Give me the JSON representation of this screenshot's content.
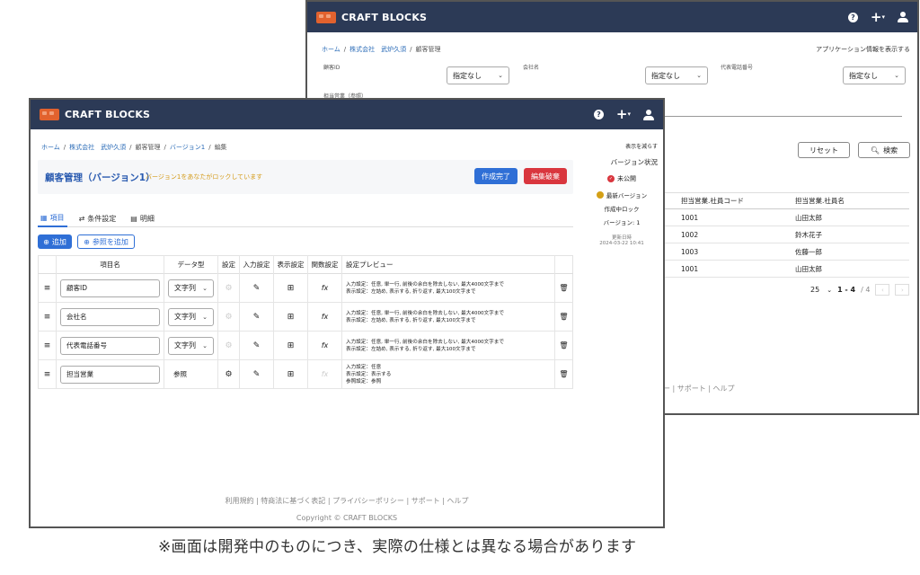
{
  "brand": "CRAFT BLOCKS",
  "caption": "※画面は開発中のものにつき、実際の仕様とは異なる場合があります",
  "back": {
    "breadcrumb": [
      "ホーム",
      "株式会社　武炉久須",
      "顧客管理"
    ],
    "show_app_info": "アプリケーション情報を表示する",
    "filters": [
      {
        "label": "顧客ID",
        "value": "指定なし"
      },
      {
        "label": "会社名",
        "value": "指定なし"
      },
      {
        "label": "代表電話番号",
        "value": "指定なし"
      }
    ],
    "owner_filter_label": "担当営業（参照）",
    "reset_label": "リセット",
    "search_label": "検索",
    "columns": [
      "担当営業.社員コード",
      "担当営業.社員名"
    ],
    "rows": [
      {
        "code": "1001",
        "name": "山田太郎",
        "left": ""
      },
      {
        "code": "1002",
        "name": "鈴木花子",
        "left": ""
      },
      {
        "code": "1003",
        "name": "佐藤一郎",
        "left": ""
      },
      {
        "code": "1001",
        "name": "山田太郎",
        "left": ""
      }
    ],
    "per_page": "25",
    "page_range": "1 - 4",
    "page_total": "/ 4",
    "footer": "ー | サポート | ヘルプ"
  },
  "front": {
    "breadcrumb": [
      "ホーム",
      "株式会社　武炉久須",
      "顧客管理",
      "バージョン1",
      "編集"
    ],
    "title": "顧客管理（バージョン1）",
    "lock_note": "バージョン1をあなたがロックしています",
    "complete_label": "作成完了",
    "discard_label": "編集破棄",
    "tabs": [
      {
        "label": "項目",
        "icon": "grid-icon"
      },
      {
        "label": "条件設定",
        "icon": "condition-icon"
      },
      {
        "label": "明細",
        "icon": "list-icon"
      }
    ],
    "add_label": "追加",
    "add_ref_label": "参照を追加",
    "headers": [
      "項目名",
      "データ型",
      "設定",
      "入力設定",
      "表示設定",
      "関数設定",
      "設定プレビュー"
    ],
    "rows": [
      {
        "name": "顧客ID",
        "type": "文字列",
        "has_select": true,
        "preview": [
          "入力設定：任意, 単一行, 前後の余白を除去しない, 最大4000文字まで",
          "表示設定：左詰め, 表示する, 折り返す, 最大100文字まで"
        ]
      },
      {
        "name": "会社名",
        "type": "文字列",
        "has_select": true,
        "preview": [
          "入力設定：任意, 単一行, 前後の余白を除去しない, 最大4000文字まで",
          "表示設定：左詰め, 表示する, 折り返す, 最大100文字まで"
        ]
      },
      {
        "name": "代表電話番号",
        "type": "文字列",
        "has_select": true,
        "preview": [
          "入力設定：任意, 単一行, 前後の余白を除去しない, 最大4000文字まで",
          "表示設定：左詰め, 表示する, 折り返す, 最大100文字まで"
        ]
      },
      {
        "name": "担当営業",
        "type": "参照",
        "has_select": false,
        "preview": [
          "入力設定：任意",
          "表示設定：表示する",
          "参照設定：参照"
        ]
      }
    ],
    "side": {
      "reduce": "表示を減らす",
      "status_title": "バージョン状況",
      "unpublished": "未公開",
      "latest": "最新バージョン",
      "locked": "作成中ロック",
      "version": "バージョン: 1",
      "updated_label": "更新日時",
      "updated_at": "2024-03-22 10:41"
    },
    "footer_links": "利用規約 | 特商法に基づく表記 | プライバシーポリシー | サポート | ヘルプ",
    "copyright": "Copyright ©  CRAFT BLOCKS"
  },
  "colors": {
    "topbar": "#2c3a56",
    "primary": "#2f6fd6",
    "danger": "#d9363e",
    "link": "#2a6bb7",
    "lock": "#d4a017"
  }
}
